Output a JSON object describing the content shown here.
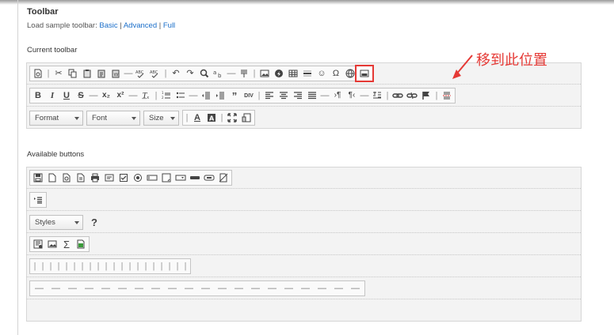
{
  "header": {
    "title": "Toolbar",
    "sample_prefix": "Load sample toolbar: ",
    "samples": [
      "Basic",
      "Advanced",
      "Full"
    ],
    "separator": " | "
  },
  "current_toolbar": {
    "label": "Current toolbar",
    "combos": {
      "format": "Format",
      "font": "Font",
      "size": "Size"
    },
    "row1_icons": [
      "source-icon",
      "bar",
      "cut-icon",
      "copy-icon",
      "paste-icon",
      "paste-text-icon",
      "paste-word-icon",
      "separator",
      "spellcheck-icon",
      "scayt-icon",
      "bar",
      "undo-icon",
      "redo-icon",
      "find-icon",
      "replace-icon",
      "separator",
      "select-all-icon",
      "bar",
      "image-icon",
      "flash-icon",
      "table-icon",
      "horizontal-rule-icon",
      "smiley-icon",
      "special-char-icon",
      "iframe-icon",
      "youtube-icon"
    ],
    "row2_icons": [
      "bold-icon",
      "italic-icon",
      "underline-icon",
      "strike-icon",
      "separator",
      "subscript-icon",
      "superscript-icon",
      "separator",
      "remove-format-icon",
      "bar",
      "numbered-list-icon",
      "bulleted-list-icon",
      "separator",
      "outdent-icon",
      "indent-icon",
      "blockquote-icon",
      "div-icon",
      "bar",
      "align-left-icon",
      "align-center-icon",
      "align-right-icon",
      "justify-icon",
      "separator",
      "ltr-icon",
      "rtl-icon",
      "separator",
      "language-icon",
      "bar",
      "link-icon",
      "unlink-icon",
      "anchor-icon",
      "bar",
      "page-break-icon"
    ]
  },
  "annotation": {
    "text": "移到此位置",
    "color": "#e53935"
  },
  "available_buttons": {
    "label": "Available buttons",
    "row1_icons": [
      "save-icon",
      "new-page-icon",
      "preview-icon",
      "templates-icon",
      "print-icon",
      "form-icon",
      "checkbox-icon",
      "radio-icon",
      "textfield-icon",
      "textarea-icon",
      "select-icon",
      "button-icon",
      "image-button-icon",
      "hidden-field-icon"
    ],
    "row2_icons": [
      "create-div-icon"
    ],
    "styles_combo": "Styles",
    "help_label": "?",
    "row4_icons": [
      "show-blocks-icon",
      "image-icon",
      "math-icon",
      "spreadsheet-icon"
    ],
    "separator_count": 20,
    "dash_count": 20
  },
  "colors": {
    "link": "#1a6ec9",
    "panel_bg": "#f3f3f3",
    "highlight": "#e53935"
  }
}
